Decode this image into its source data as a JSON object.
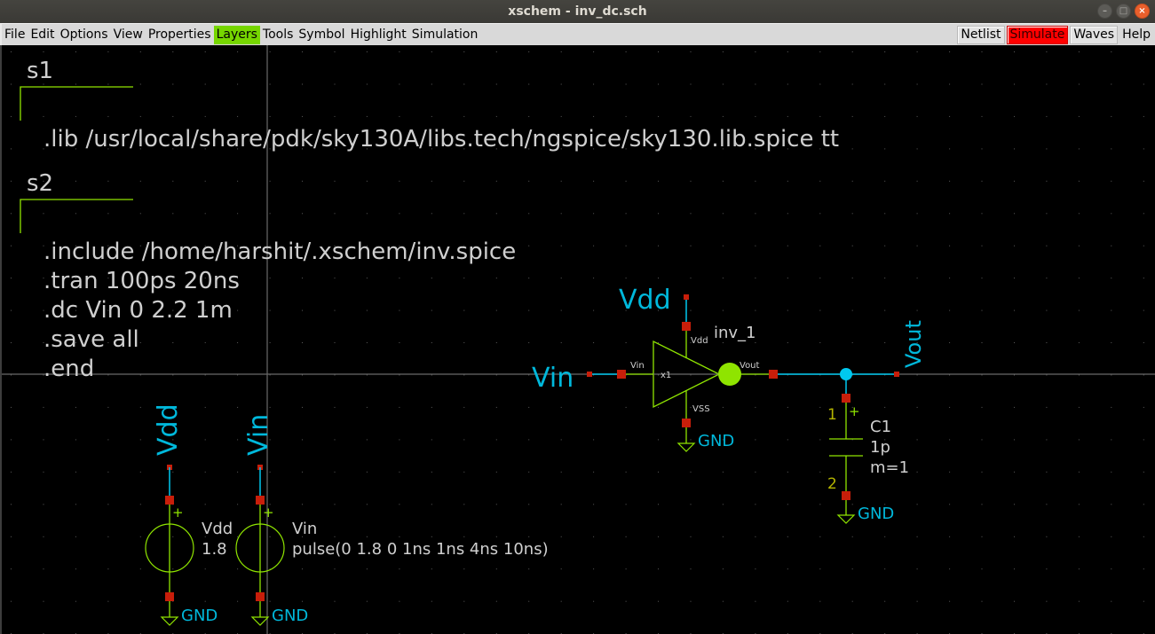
{
  "window": {
    "title": "xschem - inv_dc.sch",
    "controls": [
      "minimize",
      "maximize",
      "close"
    ]
  },
  "menubar": {
    "items": [
      {
        "label": "File",
        "active": false
      },
      {
        "label": "Edit",
        "active": false
      },
      {
        "label": "Options",
        "active": false
      },
      {
        "label": "View",
        "active": false
      },
      {
        "label": "Properties",
        "active": false
      },
      {
        "label": "Layers",
        "active": true
      },
      {
        "label": "Tools",
        "active": false
      },
      {
        "label": "Symbol",
        "active": false
      },
      {
        "label": "Highlight",
        "active": false
      },
      {
        "label": "Simulation",
        "active": false
      }
    ],
    "buttons": {
      "netlist": "Netlist",
      "simulate": "Simulate",
      "waves": "Waves",
      "help": "Help"
    }
  },
  "colors": {
    "wire": "#00c8ef",
    "symbol": "#8fe400",
    "pin": "#c81e0a",
    "text": "#cfcfcf",
    "net_label": "#00b8db",
    "simulate_button": "#ff0000",
    "active_menu": "#76d600"
  },
  "schematic": {
    "code_blocks": [
      {
        "name": "s1",
        "lines": [
          ".lib /usr/local/share/pdk/sky130A/libs.tech/ngspice/sky130.lib.spice tt"
        ]
      },
      {
        "name": "s2",
        "lines": [
          ".include /home/harshit/.xschem/inv.spice",
          ".tran 100ps 20ns",
          ".dc Vin 0 2.2 1m",
          ".save all",
          ".end"
        ]
      }
    ],
    "inverter": {
      "instance": "inv_1",
      "cell": "x1",
      "pins": {
        "in": "Vin",
        "out": "Vout",
        "vdd": "Vdd",
        "vss": "VSS"
      }
    },
    "net_labels": {
      "vin_input": "Vin",
      "vdd_top": "Vdd",
      "vout": "Vout",
      "vdd_source": "Vdd",
      "vin_source": "Vin",
      "gnd": "GND"
    },
    "capacitor": {
      "name": "C1",
      "value": "1p",
      "mult": "m=1",
      "pin1": "1",
      "pin2": "2",
      "plus": "+"
    },
    "sources": [
      {
        "name": "Vdd",
        "value": "1.8",
        "plus": "+"
      },
      {
        "name": "Vin",
        "value": "pulse(0 1.8 0 1ns 1ns 4ns 10ns)",
        "plus": "+"
      }
    ]
  }
}
